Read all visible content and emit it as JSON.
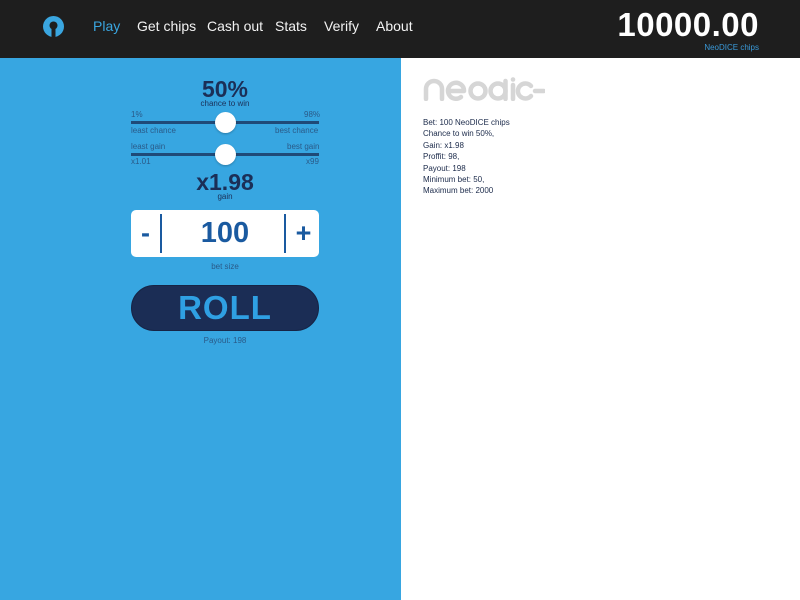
{
  "header": {
    "logo_icon": "target-ring-icon",
    "nav": [
      "Play",
      "Get chips",
      "Cash out",
      "Stats",
      "Verify",
      "About"
    ],
    "active_nav": "Play",
    "balance": "10000.00",
    "balance_unit": "NeoDICE chips"
  },
  "game": {
    "chance_value": "50%",
    "chance_label": "chance to win",
    "chance_min": "1%",
    "chance_max": "98%",
    "chance_min_label": "least chance",
    "chance_max_label": "best chance",
    "chance_slider_fraction": 0.5,
    "gain_min_label": "least gain",
    "gain_max_label": "best gain",
    "gain_min": "x1.01",
    "gain_max": "x99",
    "gain_slider_fraction": 0.5,
    "gain_value": "x1.98",
    "gain_label": "gain",
    "minus_label": "-",
    "plus_label": "+",
    "bet_value": "100",
    "bet_label": "bet size",
    "roll_label": "ROLL",
    "payout_text": "Payout: 198"
  },
  "brand": "neodice",
  "info_lines": [
    "Bet: 100 NeoDICE chips",
    "Chance to win 50%,",
    "Gain: x1.98",
    "Proffit: 98,",
    "Payout: 198",
    "Minimum bet: 50,",
    "Maximum bet: 2000"
  ],
  "colors": {
    "topbar": "#1e1e1e",
    "accent": "#3aa6e0",
    "panel": "#37a6e1",
    "roll_button": "#1b2d55",
    "dark_text": "#1b2f57"
  }
}
